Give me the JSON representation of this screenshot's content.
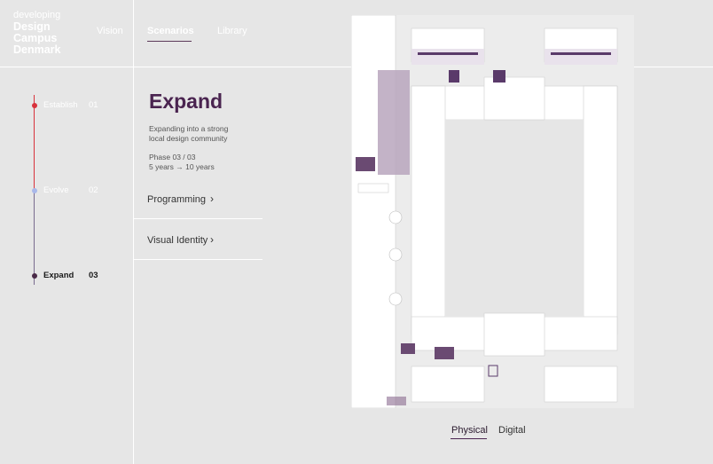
{
  "logo": {
    "small": "developing",
    "line1": "Design",
    "line2": "Campus",
    "line3": "Denmark"
  },
  "nav": {
    "vision": "Vision",
    "scenarios": "Scenarios",
    "library": "Library"
  },
  "timeline": {
    "steps": [
      {
        "label": "Establish",
        "num": "01"
      },
      {
        "label": "Evolve",
        "num": "02"
      },
      {
        "label": "Expand",
        "num": "03"
      }
    ]
  },
  "scenario": {
    "title": "Expand",
    "desc_line1": "Expanding into a strong",
    "desc_line2": "local design community",
    "phase_line1": "Phase 03 / 03",
    "phase_line2": "5 years → 10 years"
  },
  "accordion": {
    "programming": "Programming",
    "visual_identity": "Visual Identity"
  },
  "view_toggle": {
    "physical": "Physical",
    "digital": "Digital"
  },
  "colors": {
    "accent_purple": "#4a2450",
    "establish_red": "#d8323c",
    "evolve_blue": "#a9b8ea"
  }
}
